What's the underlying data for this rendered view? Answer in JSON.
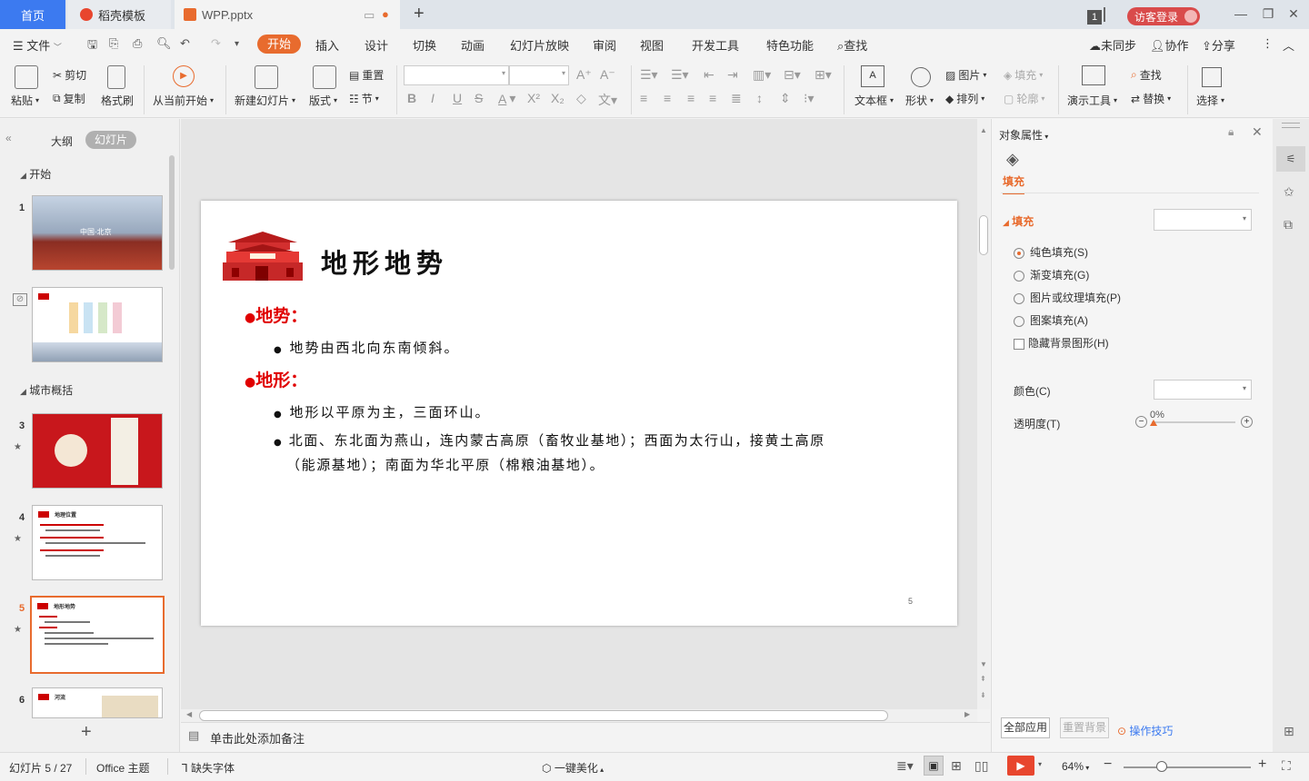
{
  "tabs": {
    "home": "首页",
    "template": "稻壳模板",
    "doc": "WPP.pptx",
    "count": "1",
    "login": "访客登录"
  },
  "menu": {
    "file": "文件",
    "items": [
      "开始",
      "插入",
      "设计",
      "切换",
      "动画",
      "幻灯片放映",
      "审阅",
      "视图",
      "开发工具",
      "特色功能"
    ],
    "search": "查找",
    "unsynced": "未同步",
    "collab": "协作",
    "share": "分享"
  },
  "ribbon": {
    "paste": "粘贴",
    "cut": "剪切",
    "copy": "复制",
    "format_painter": "格式刷",
    "play_from_current": "从当前开始",
    "new_slide": "新建幻灯片",
    "layout": "版式",
    "reset": "重置",
    "section": "节",
    "textbox": "文本框",
    "shape": "形状",
    "picture": "图片",
    "fill": "填充",
    "arrange": "排列",
    "outline": "轮廓",
    "present_tools": "演示工具",
    "find": "查找",
    "replace": "替换",
    "select": "选择"
  },
  "left_panel": {
    "outline_tab": "大纲",
    "slides_tab": "幻灯片",
    "section1": "开始",
    "section2": "城市概括",
    "slide_numbers": [
      "1",
      "3",
      "4",
      "5",
      "6"
    ],
    "thumb1_text": "中国·北京",
    "thumb4_title": "地理位置",
    "thumb5_title": "地形地势",
    "thumb6_title": "河流"
  },
  "slide": {
    "title": "地形地势",
    "h1": "地势：",
    "b1": "地势由西北向东南倾斜。",
    "h2": "地形：",
    "b2": "地形以平原为主，三面环山。",
    "b3_line1": "北面、东北面为燕山，连内蒙古高原（畜牧业基地）；西面为太行山，接黄土高原",
    "b3_line2": "（能源基地）；南面为华北平原（棉粮油基地）。",
    "page_number": "5"
  },
  "notes_placeholder": "单击此处添加备注",
  "right_panel": {
    "title": "对象属性",
    "tab_fill": "填充",
    "fill_header": "填充",
    "options": [
      "纯色填充(S)",
      "渐变填充(G)",
      "图片或纹理填充(P)",
      "图案填充(A)"
    ],
    "selected_option": 0,
    "hide_bg": "隐藏背景图形(H)",
    "color_label": "颜色(C)",
    "transparency_label": "透明度(T)",
    "transparency_value": "0%",
    "transparency_level": 0,
    "apply_all": "全部应用",
    "reset_bg": "重置背景",
    "tips": "操作技巧"
  },
  "status": {
    "slide_info": "幻灯片 5 / 27",
    "theme": "Office 主题",
    "missing_font": "缺失字体",
    "beautify": "一键美化",
    "zoom": "64%"
  },
  "colors": {
    "accent": "#e86b2e",
    "slide_red": "#e00000",
    "home_tab": "#3c7af0"
  }
}
